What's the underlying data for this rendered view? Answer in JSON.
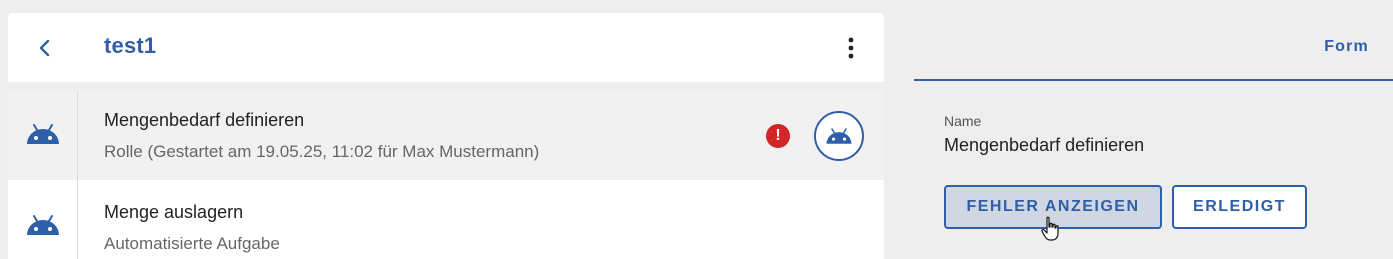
{
  "header": {
    "title": "test1",
    "back_icon": "chevron-left-icon",
    "more_icon": "more-vertical-icon"
  },
  "tasks": [
    {
      "title": "Mengenbedarf definieren",
      "subtitle": "Rolle (Gestartet am 19.05.25, 11:02 für Max Mustermann)",
      "icon": "android-icon",
      "selected": true,
      "error_badge": "!",
      "action_icon": "android-icon"
    },
    {
      "title": "Menge auslagern",
      "subtitle": "Automatisierte Aufgabe",
      "icon": "android-icon",
      "selected": false
    }
  ],
  "detail": {
    "tab_label": "Form",
    "field_label": "Name",
    "field_value": "Mengenbedarf definieren",
    "show_errors_label": "FEHLER ANZEIGEN",
    "done_label": "ERLEDIGT"
  },
  "colors": {
    "accent": "#2f5fa8",
    "error": "#d32525",
    "background": "#eeeeee",
    "selected_row": "#f1f1f1"
  }
}
